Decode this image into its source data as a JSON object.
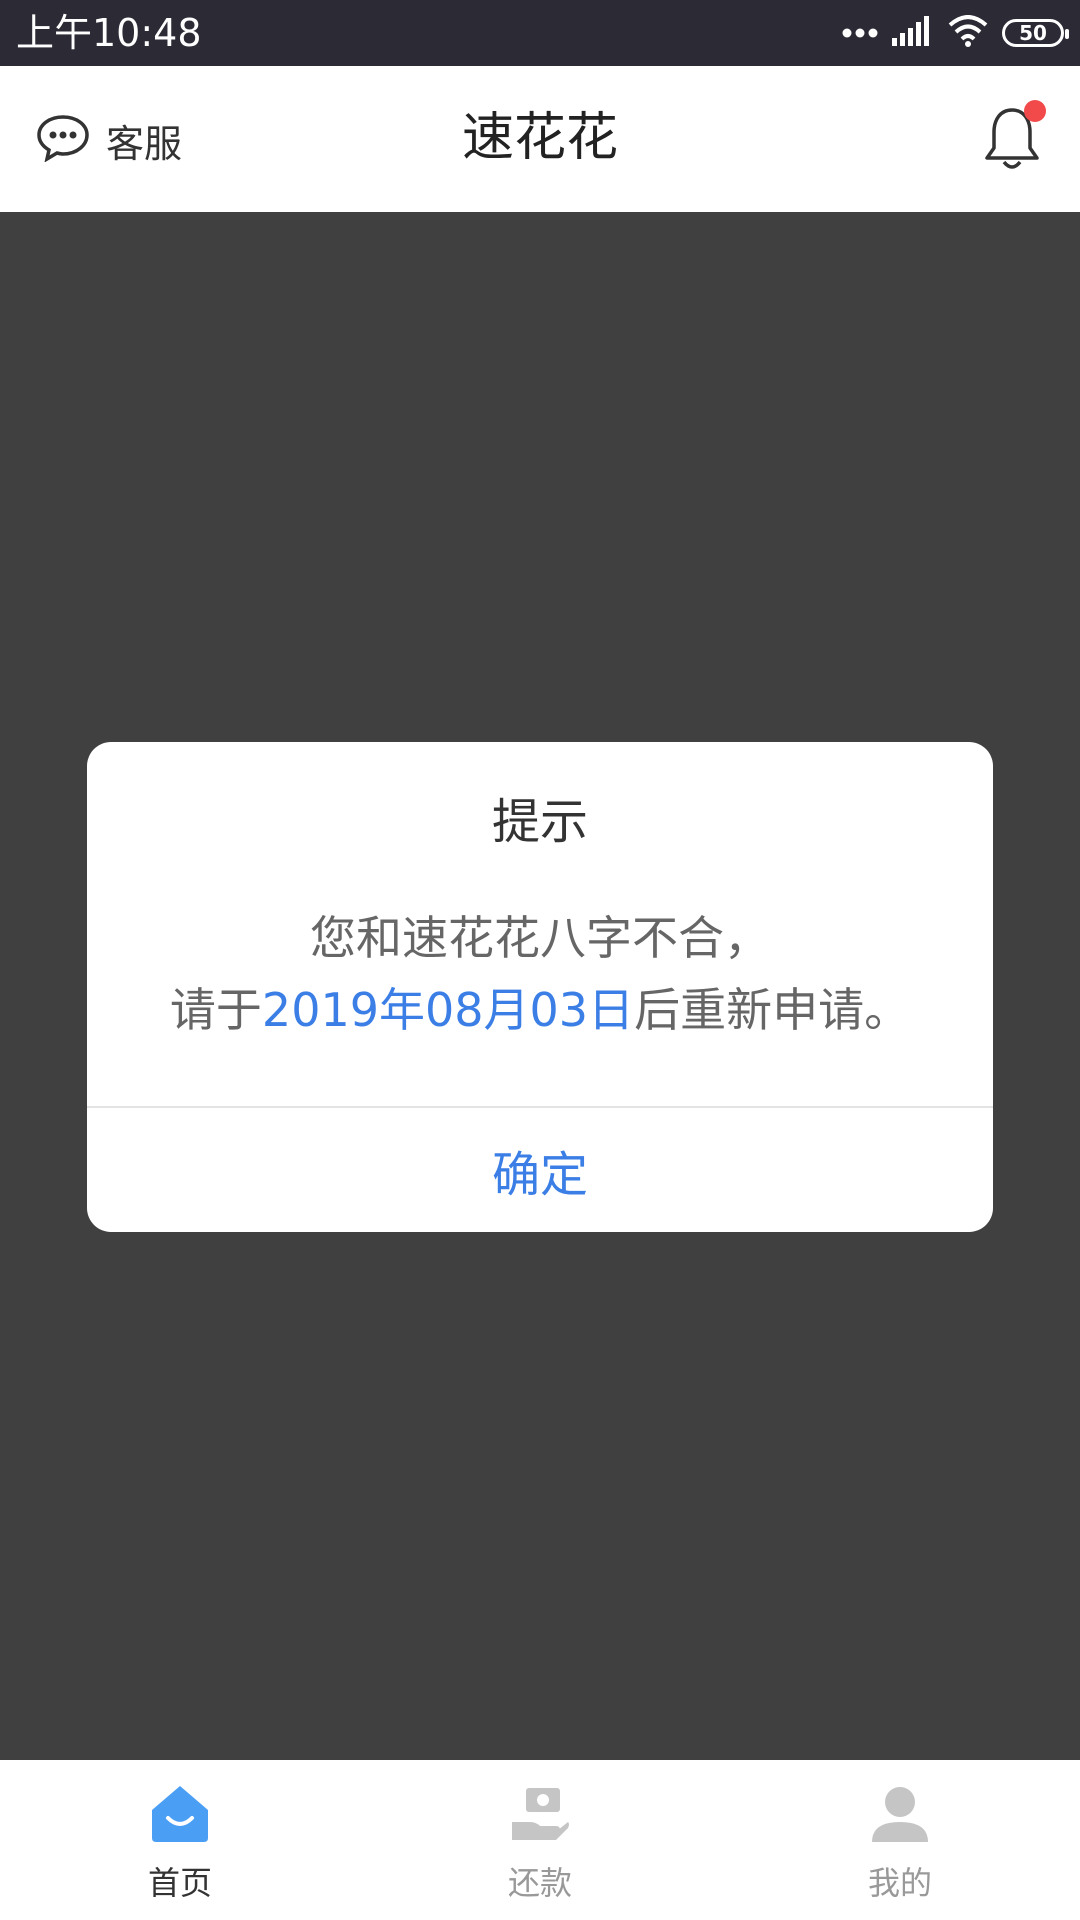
{
  "status_bar": {
    "time": "上午10:48",
    "battery": "50"
  },
  "header": {
    "service_label": "客服",
    "title": "速花花"
  },
  "dialog": {
    "title": "提示",
    "line1": "您和速花花八字不合，",
    "line2_prefix": "请于",
    "line2_date": "2019年08月03日",
    "line2_suffix": "后重新申请。",
    "confirm_label": "确定"
  },
  "bottom_nav": {
    "items": [
      {
        "label": "首页",
        "icon": "home-icon",
        "active": true
      },
      {
        "label": "还款",
        "icon": "repay-icon",
        "active": false
      },
      {
        "label": "我的",
        "icon": "profile-icon",
        "active": false
      }
    ]
  },
  "colors": {
    "accent": "#3a7ee6",
    "overlay": "#404041",
    "status_bar": "#2b2a35",
    "notification_dot": "#f24a4a",
    "nav_active_icon": "#4a9ff5"
  }
}
